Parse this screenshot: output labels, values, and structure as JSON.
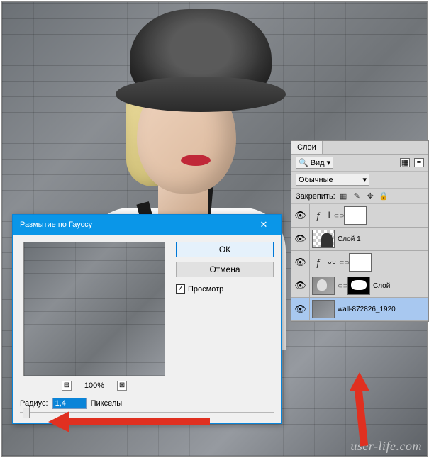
{
  "dialog": {
    "title": "Размытие по Гауссу",
    "ok": "ОК",
    "cancel": "Отмена",
    "preview_label": "Просмотр",
    "zoom": "100%",
    "radius_label": "Радиус:",
    "radius_value": "1,4",
    "radius_unit": "Пикселы"
  },
  "layers_panel": {
    "tab": "Слои",
    "view_label": "Вид",
    "blend_mode": "Обычные",
    "lock_label": "Закрепить:",
    "layers": [
      {
        "name": ""
      },
      {
        "name": "Слой 1"
      },
      {
        "name": ""
      },
      {
        "name": "Слой"
      },
      {
        "name": "wall-872826_1920"
      }
    ]
  },
  "watermark": "user-life.com",
  "icons": {
    "close": "✕",
    "check": "✓",
    "minus": "⊟",
    "plus": "⊞",
    "eye": "👁",
    "dropdown": "▾",
    "search": "🔍",
    "filter": "▦",
    "menu": "≡",
    "link": "⊂⊃",
    "checker": "▦",
    "brush": "✎",
    "move": "✥",
    "lock": "🔒",
    "levels": "⫴",
    "adjust": "ƒ",
    "curves": "〰"
  }
}
